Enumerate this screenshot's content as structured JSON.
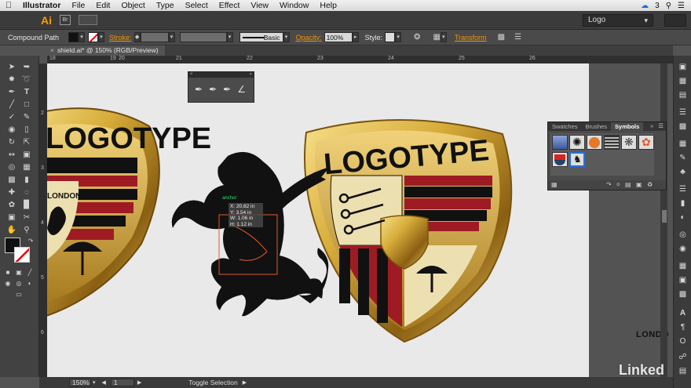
{
  "menubar": {
    "app_name": "Illustrator",
    "items": [
      "File",
      "Edit",
      "Object",
      "Type",
      "Select",
      "Effect",
      "View",
      "Window",
      "Help"
    ],
    "cc_count": "3"
  },
  "appbar": {
    "logo": "Ai",
    "bridge": "Br",
    "workspace": "Logo"
  },
  "control": {
    "selection_type": "Compound Path",
    "stroke_label": "Stroke:",
    "brush_label": "Basic",
    "opacity_label": "Opacity:",
    "opacity_value": "100%",
    "style_label": "Style:",
    "transform_label": "Transform"
  },
  "document": {
    "tab_title": "shield.ai* @ 150% (RGB/Preview)"
  },
  "rulers": {
    "top": [
      "18",
      "19",
      "20",
      "21",
      "22",
      "23",
      "24",
      "25",
      "26"
    ],
    "left": [
      "2",
      "3",
      "4",
      "5",
      "6"
    ]
  },
  "artwork": {
    "logotype": "LOGOTYPE",
    "london_partial": "LONDON",
    "london_right_partial": "LONDO",
    "anchor_label": "anchor"
  },
  "readout": {
    "x": "X: 20.82 in",
    "y": "Y: 3.54 in",
    "w": "W: 1.06 in",
    "h": "H: 1.12 in"
  },
  "symbols_panel": {
    "tabs": [
      "Swatches",
      "Brushes",
      "Symbols"
    ],
    "active_tab": "Symbols"
  },
  "statusbar": {
    "zoom": "150%",
    "artboard": "1",
    "status_text": "Toggle Selection"
  },
  "watermark": "Linked"
}
